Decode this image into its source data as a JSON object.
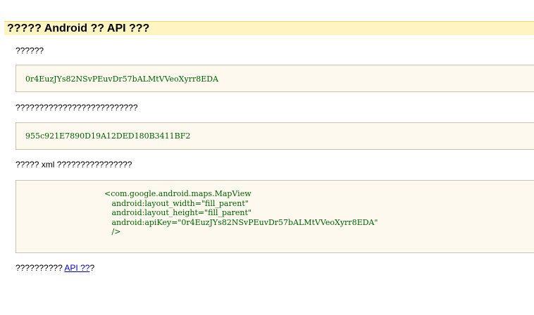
{
  "title": "????? Android ?? API ???",
  "sections": [
    {
      "label": "??????",
      "code": "0r4EuzJYs82NSvPEuvDr57bALMtVVeoXyrr8EDA"
    },
    {
      "label": "??????????????????????????",
      "code": "955c921E7890D19A12DED180B3411BF2"
    },
    {
      "label": "????? xml ????????????????",
      "code": "<com.google.android.maps.MapView\n   android:layout_width=\"fill_parent\"\n   android:layout_height=\"fill_parent\"\n   android:apiKey=\"0r4EuzJYs82NSvPEuvDr57bALMtVVeoXyrr8EDA\"\n   />"
    }
  ],
  "footer": {
    "prefix": "?????????? ",
    "link_text": "API ??",
    "suffix": "?"
  },
  "colors": {
    "header_bg": "#fff4c2",
    "code_bg": "#fef9ef",
    "code_text": "#006000",
    "link": "#0000cc"
  }
}
